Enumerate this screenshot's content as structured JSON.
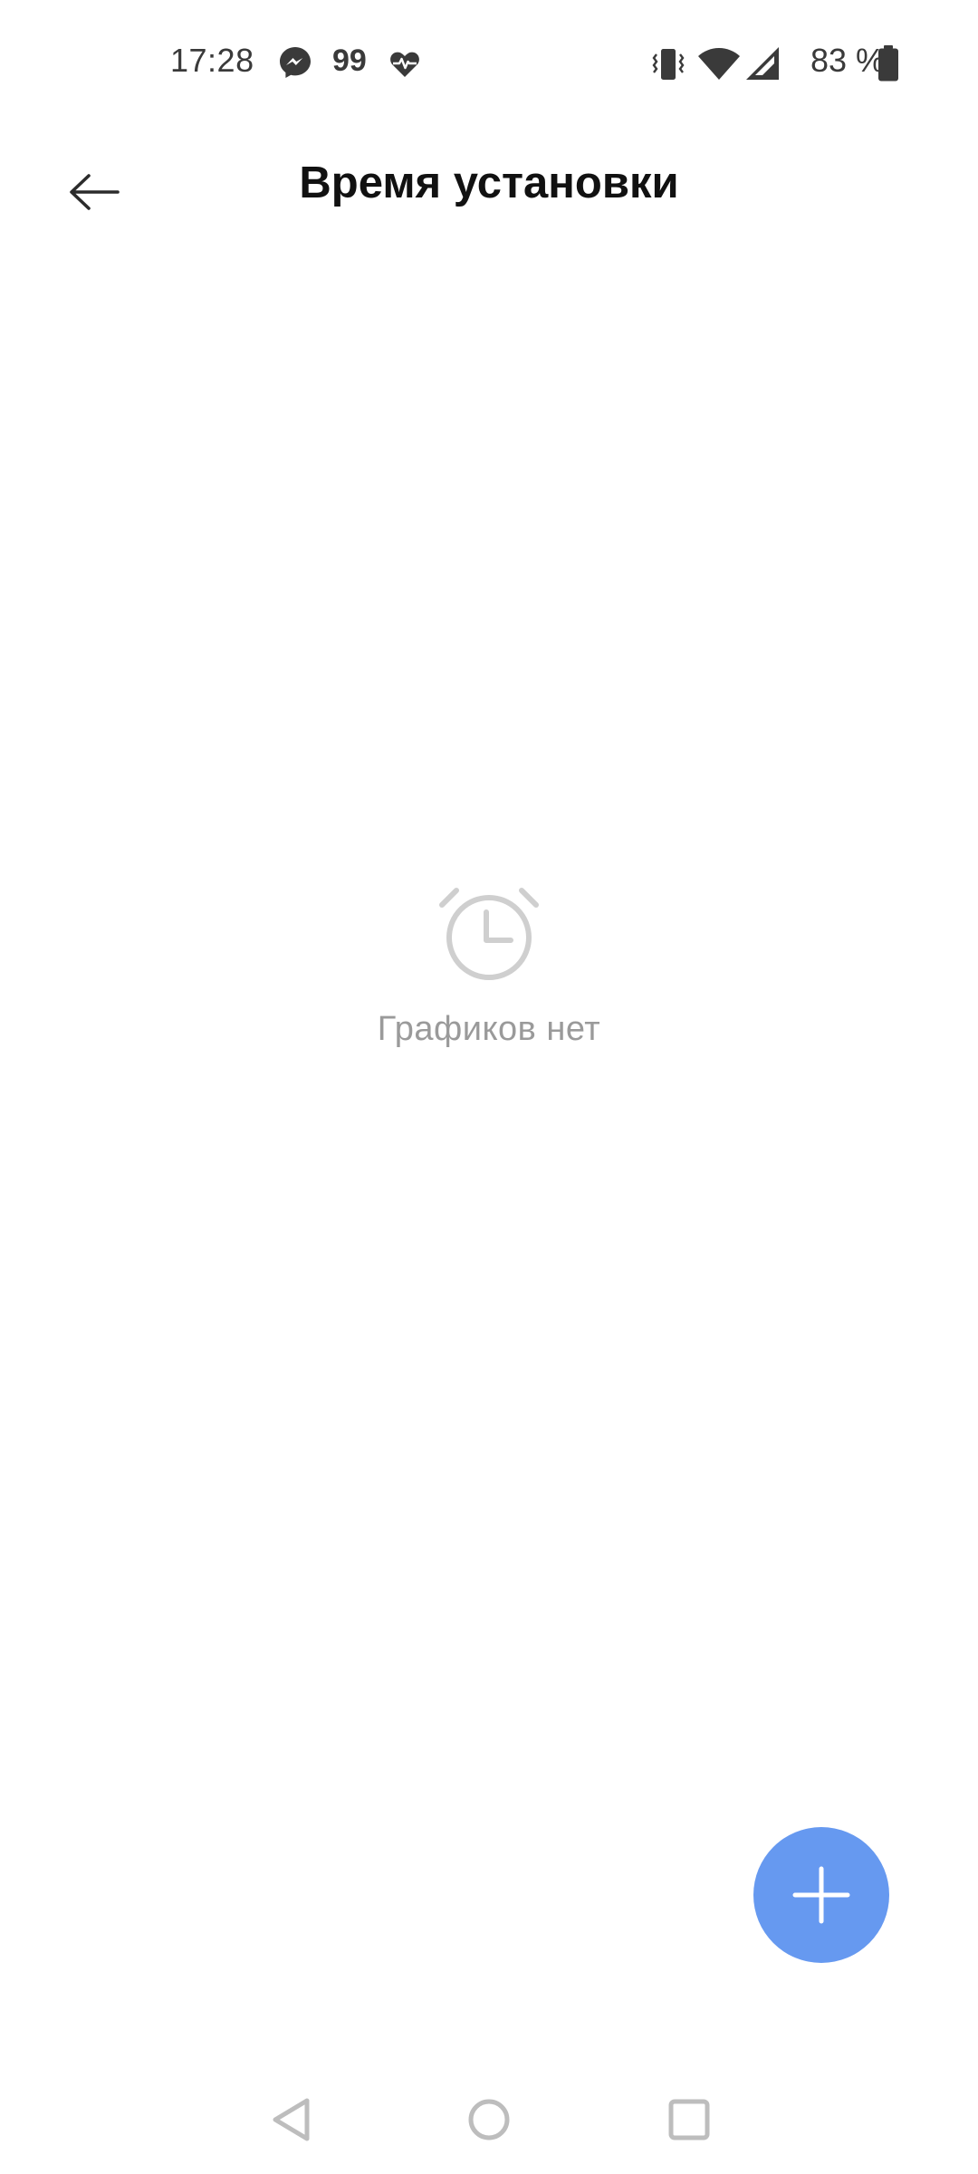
{
  "status_bar": {
    "time": "17:28",
    "notification_count": "99",
    "battery_percent": "83 %",
    "icons": [
      "messenger-icon",
      "heart-pulse-icon",
      "vibrate-icon",
      "wifi-icon",
      "signal-icon",
      "battery-icon"
    ],
    "battery_level": 0.83
  },
  "app_bar": {
    "title": "Время установки",
    "back_icon": "arrow-left-icon"
  },
  "empty_state": {
    "icon": "alarm-clock-icon",
    "text": "Графиков нет"
  },
  "fab": {
    "icon": "plus-icon",
    "color": "#6699f0"
  },
  "nav_bar": {
    "icons": [
      "nav-back-icon",
      "nav-home-icon",
      "nav-recents-icon"
    ]
  }
}
